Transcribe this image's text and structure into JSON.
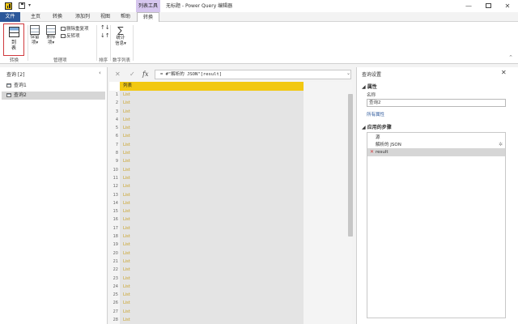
{
  "titlebar": {
    "quick_access_dropdown": "▾",
    "context_tab_header": "列表工具",
    "window_title": "无标题 - Power Query 编辑器",
    "minimize": "—",
    "close": "✕"
  },
  "tabs": [
    "文件",
    "主页",
    "转换",
    "添加列",
    "视图",
    "帮助",
    "转换"
  ],
  "ribbon": {
    "to_table": "到\n表",
    "keep_rows": "保留\n项▾",
    "remove_rows": "删除\n项▾",
    "remove_duplicates": "删除重复项",
    "reverse_rows": "反转项",
    "sort_asc": "↑↓",
    "sort_desc": "↓↑",
    "statistics": "统计\n信息▾",
    "groups": [
      "转换",
      "管理项",
      "排序",
      "数字列表"
    ],
    "collapse": "⌃"
  },
  "queries_pane": {
    "title": "查询 [2]",
    "collapse": "‹",
    "items": [
      "查询1",
      "查询2"
    ]
  },
  "formula_bar": {
    "cancel": "✕",
    "commit": "✓",
    "fx": "fx",
    "formula": "= #\"解析的 JSON\"[result]",
    "expand": "⌄"
  },
  "grid": {
    "column_header": "列表",
    "row_numbers": [
      "1",
      "2",
      "3",
      "4",
      "5",
      "6",
      "7",
      "8",
      "9",
      "10",
      "11",
      "12",
      "13",
      "14",
      "15",
      "16",
      "17",
      "18",
      "19",
      "20",
      "21",
      "22",
      "23",
      "24",
      "25",
      "26",
      "27",
      "28"
    ],
    "cell_value": "List"
  },
  "settings_pane": {
    "title": "查询设置",
    "close": "✕",
    "properties_head": "◢ 属性",
    "name_label": "名称",
    "name_value": "查询2",
    "all_properties": "所有属性",
    "steps_head": "◢ 应用的步骤",
    "steps": [
      "源",
      "解析的 JSON",
      "result"
    ],
    "gear": "✲",
    "delete": "✕"
  }
}
